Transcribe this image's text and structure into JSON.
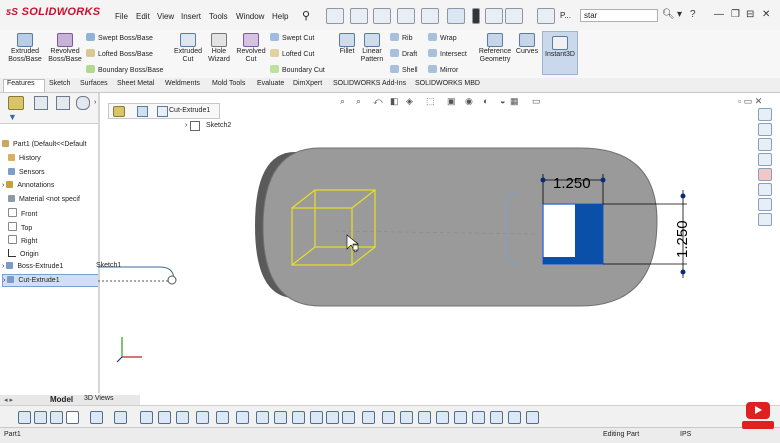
{
  "app": {
    "logo": "SOLIDWORKS"
  },
  "menu": [
    "File",
    "Edit",
    "View",
    "Insert",
    "Tools",
    "Window",
    "Help"
  ],
  "search": {
    "placeholder": "star"
  },
  "ribbon": {
    "extruded_boss": "Extruded Boss/Base",
    "revolved_boss": "Revolved Boss/Base",
    "swept_boss": "Swept Boss/Base",
    "lofted_boss": "Lofted Boss/Base",
    "boundary_boss": "Boundary Boss/Base",
    "extruded_cut": "Extruded Cut",
    "hole_wizard": "Hole Wizard",
    "revolved_cut": "Revolved Cut",
    "swept_cut": "Swept Cut",
    "lofted_cut": "Lofted Cut",
    "boundary_cut": "Boundary Cut",
    "fillet": "Fillet",
    "linear_pattern": "Linear Pattern",
    "rib": "Rib",
    "draft": "Draft",
    "shell": "Shell",
    "wrap": "Wrap",
    "intersect": "Intersect",
    "mirror": "Mirror",
    "reference_geometry": "Reference Geometry",
    "curves": "Curves",
    "instant3d": "Instant3D"
  },
  "tabs": [
    "Features",
    "Sketch",
    "Surfaces",
    "Sheet Metal",
    "Weldments",
    "Mold Tools",
    "Evaluate",
    "DimXpert",
    "SOLIDWORKS Add-Ins",
    "SOLIDWORKS MBD"
  ],
  "tree": {
    "part": "Part1  (Default<<Default",
    "items": [
      "History",
      "Sensors",
      "Annotations",
      "Material <not specif",
      "Front",
      "Top",
      "Right",
      "Origin",
      "Boss-Extrude1",
      "Cut-Extrude1"
    ],
    "sketch_flyout": "Sketch1"
  },
  "breadcrumb": {
    "item": "Cut-Extrude1",
    "sub": "Sketch2"
  },
  "dimensions": {
    "width": "1.250",
    "height": "1.250"
  },
  "bottom_tabs": [
    "Model",
    "3D Views"
  ],
  "status": {
    "part": "Part1",
    "mode": "Editing Part",
    "units": "IPS"
  }
}
